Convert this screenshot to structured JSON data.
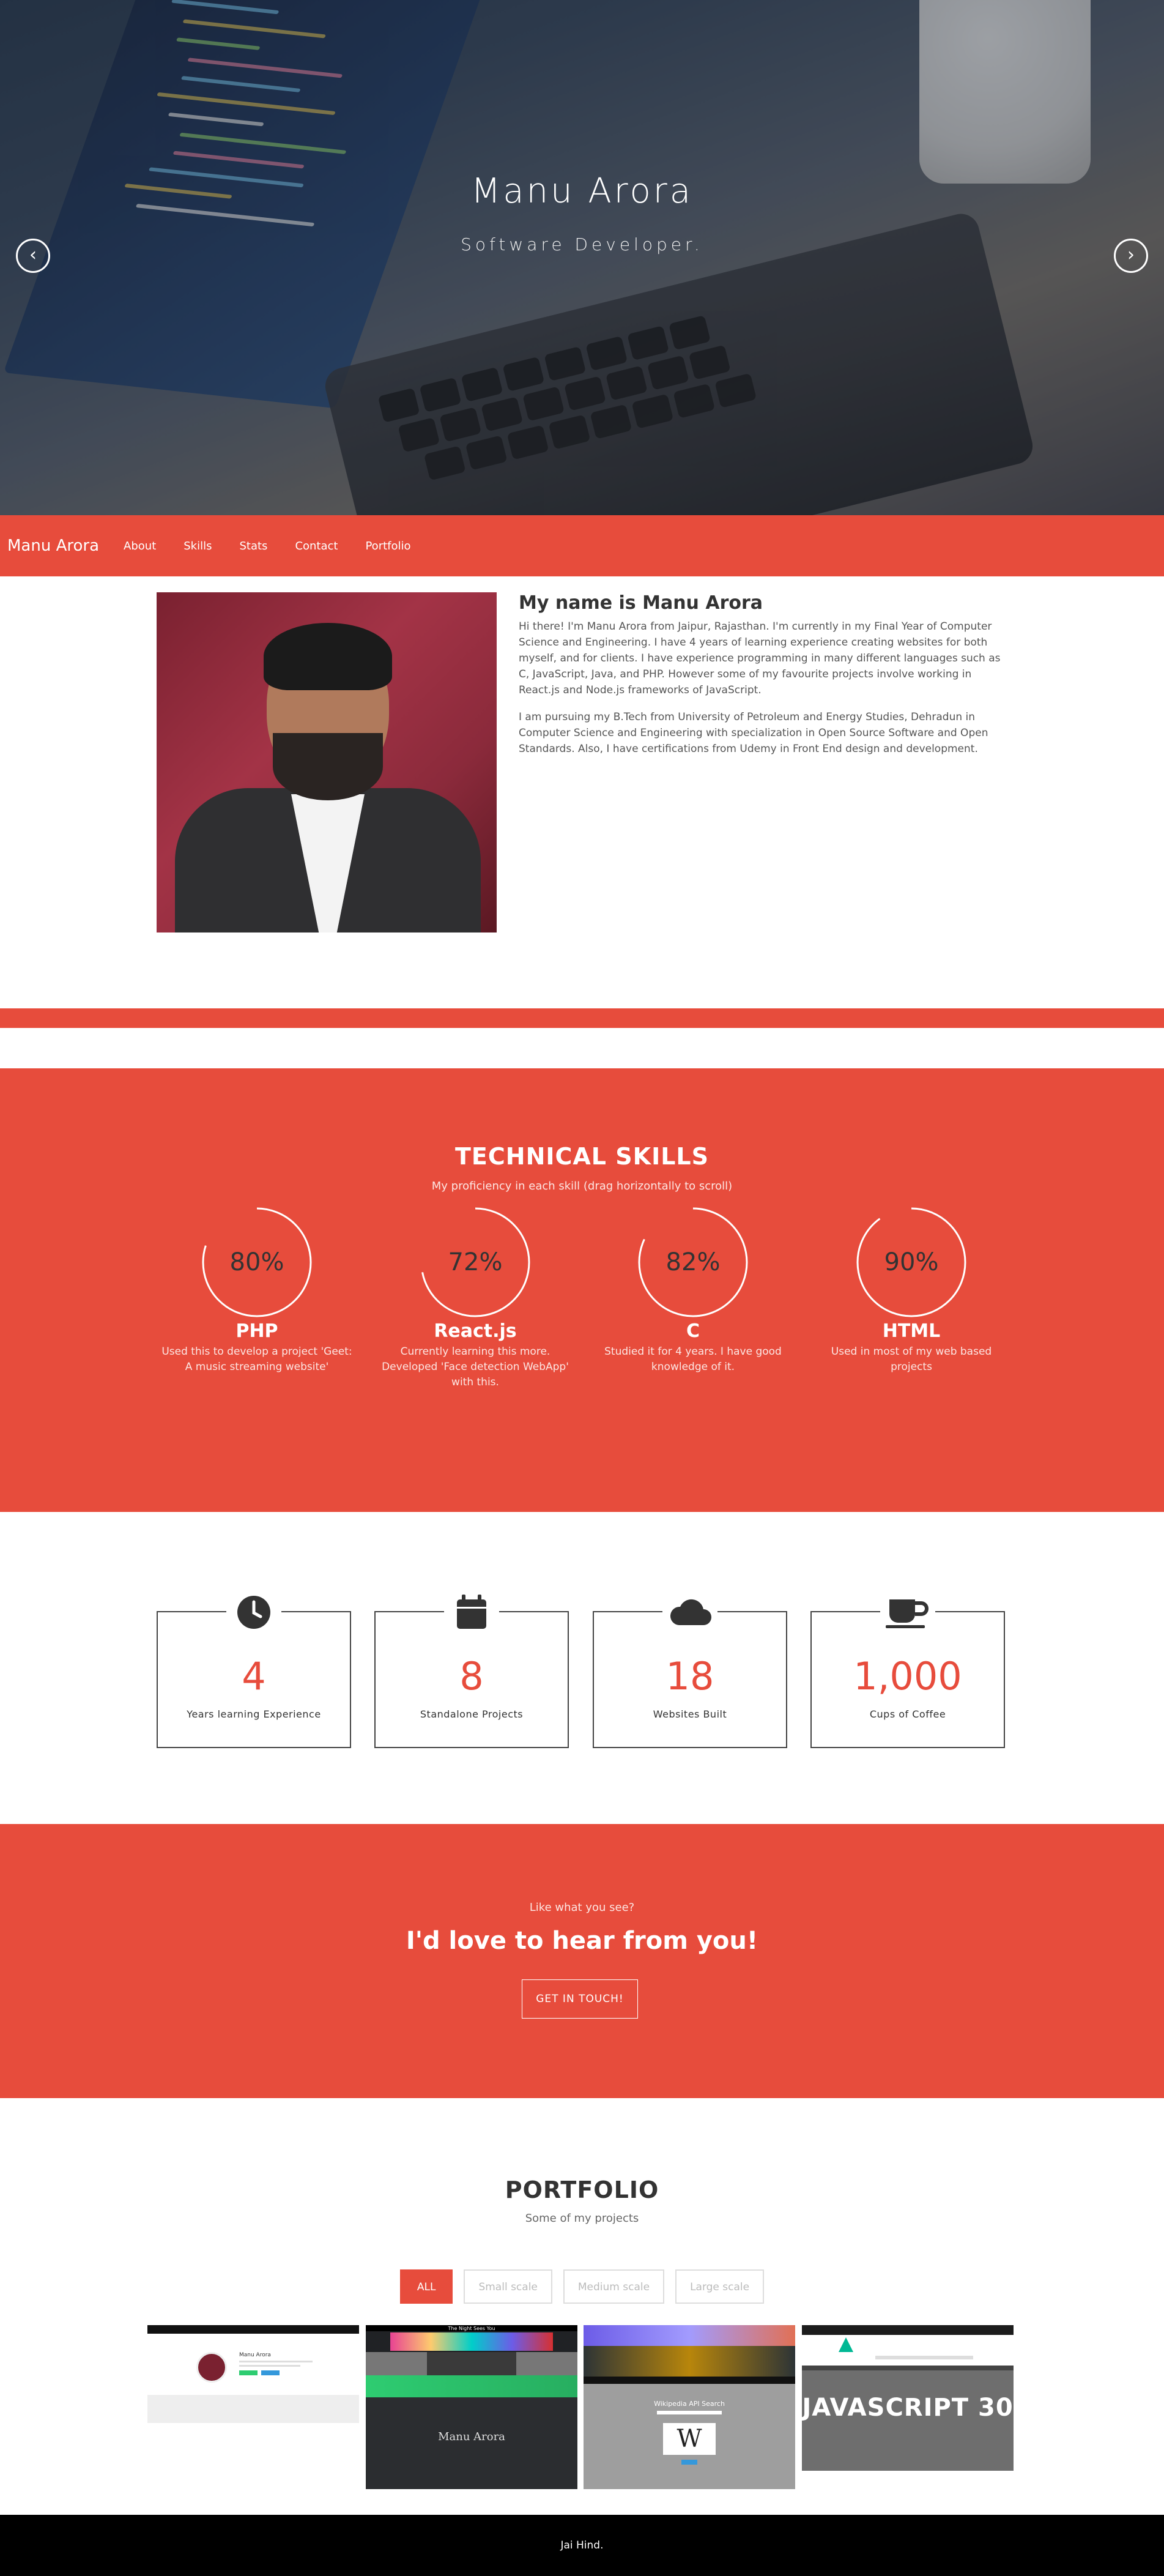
{
  "hero": {
    "title": "Manu Arora",
    "subtitle": "Software Developer."
  },
  "nav": {
    "brand": "Manu Arora",
    "links": [
      "About",
      "Skills",
      "Stats",
      "Contact",
      "Portfolio"
    ]
  },
  "about": {
    "heading": "My name is Manu Arora",
    "paragraphs": [
      "Hi there! I'm Manu Arora from Jaipur, Rajasthan. I'm currently in my Final Year of Computer Science and Engineering. I have 4 years of learning experience creating websites for both myself, and for clients. I have experience programming in many different languages such as C, JavaScript, Java, and PHP. However some of my favourite projects involve working in React.js and Node.js frameworks of JavaScript.",
      "I am pursuing my B.Tech from University of Petroleum and Energy Studies, Dehradun in Computer Science and Engineering with specialization in Open Source Software and Open Standards. Also, I have certifications from Udemy in Front End design and development."
    ]
  },
  "skills": {
    "title": "TECHNICAL SKILLS",
    "subtitle": "My proficiency in each skill (drag horizontally to scroll)",
    "items": [
      {
        "name": "PHP",
        "percent": 80,
        "percent_label": "80%",
        "desc": "Used this to develop a project 'Geet: A music streaming website'"
      },
      {
        "name": "React.js",
        "percent": 72,
        "percent_label": "72%",
        "desc": "Currently learning this more. Developed 'Face detection WebApp' with this."
      },
      {
        "name": "C",
        "percent": 82,
        "percent_label": "82%",
        "desc": "Studied it for 4 years. I have good knowledge of it."
      },
      {
        "name": "HTML",
        "percent": 90,
        "percent_label": "90%",
        "desc": "Used in most of my web based projects"
      }
    ]
  },
  "stats": {
    "items": [
      {
        "icon": "clock-icon",
        "value": "4",
        "label": "Years learning Experience"
      },
      {
        "icon": "calendar-icon",
        "value": "8",
        "label": "Standalone Projects"
      },
      {
        "icon": "cloud-icon",
        "value": "18",
        "label": "Websites Built"
      },
      {
        "icon": "coffee-cup-icon",
        "value": "1,000",
        "label": "Cups of Coffee"
      }
    ]
  },
  "cta": {
    "small": "Like what you see?",
    "big": "I'd love to hear from you!",
    "button": "GET IN TOUCH!"
  },
  "portfolio": {
    "title": "PORTFOLIO",
    "subtitle": "Some of my projects",
    "filters": [
      "ALL",
      "Small scale",
      "Medium scale",
      "Large scale"
    ],
    "active_filter": "ALL",
    "thumbs": [
      {
        "title": "Manu Arora"
      },
      {
        "title": "Manu Arora",
        "header": "The Night Sees You"
      },
      {
        "title": "Wikipedia API Search"
      },
      {
        "title": "JAVASCRIPT 30"
      }
    ]
  },
  "footer": {
    "text": "Jai Hind."
  },
  "colors": {
    "accent": "#e74c3c",
    "footer": "#000000"
  }
}
